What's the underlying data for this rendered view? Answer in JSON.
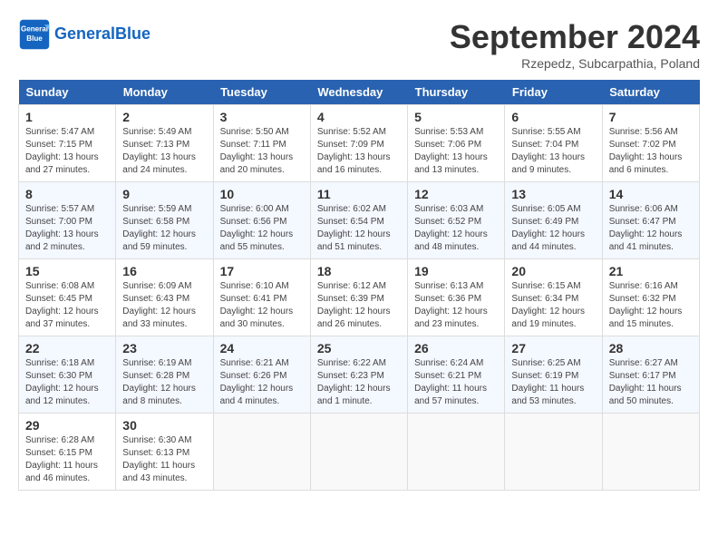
{
  "header": {
    "logo_line1": "General",
    "logo_line2": "Blue",
    "title": "September 2024",
    "location": "Rzepedz, Subcarpathia, Poland"
  },
  "weekdays": [
    "Sunday",
    "Monday",
    "Tuesday",
    "Wednesday",
    "Thursday",
    "Friday",
    "Saturday"
  ],
  "weeks": [
    [
      {
        "day": "1",
        "sunrise": "Sunrise: 5:47 AM",
        "sunset": "Sunset: 7:15 PM",
        "daylight": "Daylight: 13 hours and 27 minutes."
      },
      {
        "day": "2",
        "sunrise": "Sunrise: 5:49 AM",
        "sunset": "Sunset: 7:13 PM",
        "daylight": "Daylight: 13 hours and 24 minutes."
      },
      {
        "day": "3",
        "sunrise": "Sunrise: 5:50 AM",
        "sunset": "Sunset: 7:11 PM",
        "daylight": "Daylight: 13 hours and 20 minutes."
      },
      {
        "day": "4",
        "sunrise": "Sunrise: 5:52 AM",
        "sunset": "Sunset: 7:09 PM",
        "daylight": "Daylight: 13 hours and 16 minutes."
      },
      {
        "day": "5",
        "sunrise": "Sunrise: 5:53 AM",
        "sunset": "Sunset: 7:06 PM",
        "daylight": "Daylight: 13 hours and 13 minutes."
      },
      {
        "day": "6",
        "sunrise": "Sunrise: 5:55 AM",
        "sunset": "Sunset: 7:04 PM",
        "daylight": "Daylight: 13 hours and 9 minutes."
      },
      {
        "day": "7",
        "sunrise": "Sunrise: 5:56 AM",
        "sunset": "Sunset: 7:02 PM",
        "daylight": "Daylight: 13 hours and 6 minutes."
      }
    ],
    [
      {
        "day": "8",
        "sunrise": "Sunrise: 5:57 AM",
        "sunset": "Sunset: 7:00 PM",
        "daylight": "Daylight: 13 hours and 2 minutes."
      },
      {
        "day": "9",
        "sunrise": "Sunrise: 5:59 AM",
        "sunset": "Sunset: 6:58 PM",
        "daylight": "Daylight: 12 hours and 59 minutes."
      },
      {
        "day": "10",
        "sunrise": "Sunrise: 6:00 AM",
        "sunset": "Sunset: 6:56 PM",
        "daylight": "Daylight: 12 hours and 55 minutes."
      },
      {
        "day": "11",
        "sunrise": "Sunrise: 6:02 AM",
        "sunset": "Sunset: 6:54 PM",
        "daylight": "Daylight: 12 hours and 51 minutes."
      },
      {
        "day": "12",
        "sunrise": "Sunrise: 6:03 AM",
        "sunset": "Sunset: 6:52 PM",
        "daylight": "Daylight: 12 hours and 48 minutes."
      },
      {
        "day": "13",
        "sunrise": "Sunrise: 6:05 AM",
        "sunset": "Sunset: 6:49 PM",
        "daylight": "Daylight: 12 hours and 44 minutes."
      },
      {
        "day": "14",
        "sunrise": "Sunrise: 6:06 AM",
        "sunset": "Sunset: 6:47 PM",
        "daylight": "Daylight: 12 hours and 41 minutes."
      }
    ],
    [
      {
        "day": "15",
        "sunrise": "Sunrise: 6:08 AM",
        "sunset": "Sunset: 6:45 PM",
        "daylight": "Daylight: 12 hours and 37 minutes."
      },
      {
        "day": "16",
        "sunrise": "Sunrise: 6:09 AM",
        "sunset": "Sunset: 6:43 PM",
        "daylight": "Daylight: 12 hours and 33 minutes."
      },
      {
        "day": "17",
        "sunrise": "Sunrise: 6:10 AM",
        "sunset": "Sunset: 6:41 PM",
        "daylight": "Daylight: 12 hours and 30 minutes."
      },
      {
        "day": "18",
        "sunrise": "Sunrise: 6:12 AM",
        "sunset": "Sunset: 6:39 PM",
        "daylight": "Daylight: 12 hours and 26 minutes."
      },
      {
        "day": "19",
        "sunrise": "Sunrise: 6:13 AM",
        "sunset": "Sunset: 6:36 PM",
        "daylight": "Daylight: 12 hours and 23 minutes."
      },
      {
        "day": "20",
        "sunrise": "Sunrise: 6:15 AM",
        "sunset": "Sunset: 6:34 PM",
        "daylight": "Daylight: 12 hours and 19 minutes."
      },
      {
        "day": "21",
        "sunrise": "Sunrise: 6:16 AM",
        "sunset": "Sunset: 6:32 PM",
        "daylight": "Daylight: 12 hours and 15 minutes."
      }
    ],
    [
      {
        "day": "22",
        "sunrise": "Sunrise: 6:18 AM",
        "sunset": "Sunset: 6:30 PM",
        "daylight": "Daylight: 12 hours and 12 minutes."
      },
      {
        "day": "23",
        "sunrise": "Sunrise: 6:19 AM",
        "sunset": "Sunset: 6:28 PM",
        "daylight": "Daylight: 12 hours and 8 minutes."
      },
      {
        "day": "24",
        "sunrise": "Sunrise: 6:21 AM",
        "sunset": "Sunset: 6:26 PM",
        "daylight": "Daylight: 12 hours and 4 minutes."
      },
      {
        "day": "25",
        "sunrise": "Sunrise: 6:22 AM",
        "sunset": "Sunset: 6:23 PM",
        "daylight": "Daylight: 12 hours and 1 minute."
      },
      {
        "day": "26",
        "sunrise": "Sunrise: 6:24 AM",
        "sunset": "Sunset: 6:21 PM",
        "daylight": "Daylight: 11 hours and 57 minutes."
      },
      {
        "day": "27",
        "sunrise": "Sunrise: 6:25 AM",
        "sunset": "Sunset: 6:19 PM",
        "daylight": "Daylight: 11 hours and 53 minutes."
      },
      {
        "day": "28",
        "sunrise": "Sunrise: 6:27 AM",
        "sunset": "Sunset: 6:17 PM",
        "daylight": "Daylight: 11 hours and 50 minutes."
      }
    ],
    [
      {
        "day": "29",
        "sunrise": "Sunrise: 6:28 AM",
        "sunset": "Sunset: 6:15 PM",
        "daylight": "Daylight: 11 hours and 46 minutes."
      },
      {
        "day": "30",
        "sunrise": "Sunrise: 6:30 AM",
        "sunset": "Sunset: 6:13 PM",
        "daylight": "Daylight: 11 hours and 43 minutes."
      },
      null,
      null,
      null,
      null,
      null
    ]
  ]
}
